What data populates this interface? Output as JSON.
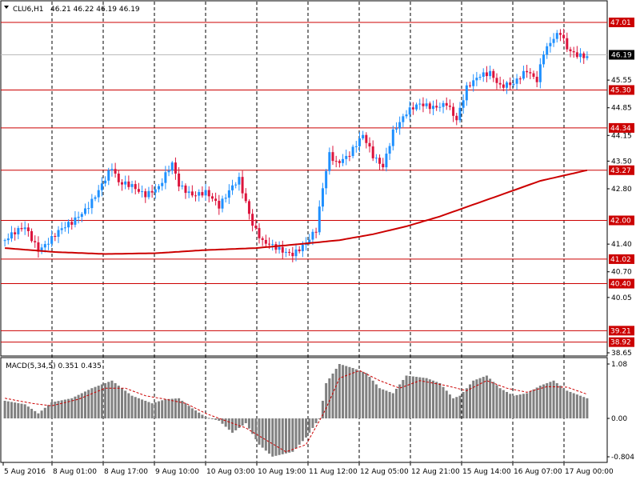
{
  "window": {
    "symbol_label": "CLU6,H1",
    "ohlc_text": "46.21 46.22 46.19 46.19"
  },
  "colors": {
    "background": "#ffffff",
    "grid": "#000000",
    "bull_candle": "#1e90ff",
    "bear_candle": "#dc143c",
    "level_line": "#cc0000",
    "ma_line": "#cc0000",
    "macd_hist": "#808080",
    "macd_signal": "#cc0000",
    "current_price_tag": "#000000"
  },
  "chart_data": [
    {
      "type": "candlestick",
      "title": "CLU6,H1",
      "timeframe": "H1",
      "ylim": [
        38.5,
        47.5
      ],
      "y_ticks": [
        47.01,
        45.55,
        44.85,
        44.15,
        43.5,
        42.8,
        41.4,
        40.7,
        40.05,
        38.65
      ],
      "x_labels": [
        "5 Aug 2016",
        "8 Aug 01:00",
        "8 Aug 17:00",
        "9 Aug 10:00",
        "10 Aug 03:00",
        "10 Aug 19:00",
        "11 Aug 12:00",
        "12 Aug 05:00",
        "12 Aug 21:00",
        "15 Aug 14:00",
        "16 Aug 07:00",
        "17 Aug 00:00"
      ],
      "current_price": 46.19,
      "levels": [
        {
          "value": 47.01,
          "label": "47.01"
        },
        {
          "value": 45.3,
          "label": "45.30"
        },
        {
          "value": 44.34,
          "label": "44.34"
        },
        {
          "value": 43.27,
          "label": "43.27"
        },
        {
          "value": 42.0,
          "label": "42.00"
        },
        {
          "value": 41.02,
          "label": "41.02"
        },
        {
          "value": 40.4,
          "label": "40.40"
        },
        {
          "value": 39.21,
          "label": "39.21"
        },
        {
          "value": 38.92,
          "label": "38.92"
        }
      ],
      "price_path": [
        [
          0,
          41.5
        ],
        [
          6,
          41.8
        ],
        [
          10,
          41.3
        ],
        [
          16,
          41.7
        ],
        [
          20,
          41.9
        ],
        [
          24,
          42.3
        ],
        [
          28,
          42.8
        ],
        [
          32,
          43.3
        ],
        [
          34,
          42.9
        ],
        [
          38,
          42.9
        ],
        [
          42,
          42.7
        ],
        [
          46,
          42.8
        ],
        [
          50,
          43.4
        ],
        [
          52,
          42.9
        ],
        [
          56,
          42.7
        ],
        [
          60,
          42.7
        ],
        [
          64,
          42.3
        ],
        [
          68,
          42.9
        ],
        [
          70,
          43.1
        ],
        [
          72,
          42.5
        ],
        [
          74,
          41.9
        ],
        [
          77,
          41.4
        ],
        [
          81,
          41.3
        ],
        [
          86,
          41.2
        ],
        [
          90,
          41.4
        ],
        [
          93,
          41.7
        ],
        [
          95,
          42.8
        ],
        [
          97,
          43.7
        ],
        [
          99,
          43.5
        ],
        [
          103,
          43.7
        ],
        [
          107,
          44.1
        ],
        [
          110,
          43.6
        ],
        [
          113,
          43.4
        ],
        [
          116,
          44.3
        ],
        [
          120,
          44.7
        ],
        [
          124,
          44.9
        ],
        [
          128,
          44.9
        ],
        [
          132,
          45.0
        ],
        [
          135,
          44.5
        ],
        [
          138,
          45.3
        ],
        [
          142,
          45.7
        ],
        [
          145,
          45.8
        ],
        [
          148,
          45.4
        ],
        [
          152,
          45.4
        ],
        [
          156,
          45.8
        ],
        [
          159,
          45.6
        ],
        [
          161,
          46.3
        ],
        [
          164,
          46.6
        ],
        [
          166,
          46.7
        ],
        [
          168,
          46.3
        ],
        [
          170,
          46.2
        ],
        [
          174,
          46.2
        ]
      ],
      "ma_path": [
        [
          0,
          41.3
        ],
        [
          15,
          41.2
        ],
        [
          30,
          41.15
        ],
        [
          45,
          41.17
        ],
        [
          60,
          41.25
        ],
        [
          75,
          41.3
        ],
        [
          88,
          41.4
        ],
        [
          100,
          41.5
        ],
        [
          110,
          41.65
        ],
        [
          120,
          41.85
        ],
        [
          130,
          42.1
        ],
        [
          140,
          42.4
        ],
        [
          150,
          42.7
        ],
        [
          160,
          43.0
        ],
        [
          174,
          43.27
        ]
      ]
    },
    {
      "type": "bar",
      "title": "MACD(5,34,5) 0.351 0.435",
      "ylim": [
        -0.804,
        1.08
      ],
      "y_ticks": [
        1.08,
        0.0,
        -0.804
      ],
      "hist_path": [
        [
          0,
          0.35
        ],
        [
          6,
          0.28
        ],
        [
          10,
          0.1
        ],
        [
          14,
          0.32
        ],
        [
          20,
          0.4
        ],
        [
          26,
          0.6
        ],
        [
          32,
          0.75
        ],
        [
          38,
          0.45
        ],
        [
          44,
          0.3
        ],
        [
          48,
          0.38
        ],
        [
          52,
          0.4
        ],
        [
          56,
          0.2
        ],
        [
          60,
          0.03
        ],
        [
          64,
          -0.05
        ],
        [
          68,
          -0.3
        ],
        [
          72,
          -0.1
        ],
        [
          76,
          -0.55
        ],
        [
          80,
          -0.8
        ],
        [
          86,
          -0.7
        ],
        [
          90,
          -0.4
        ],
        [
          94,
          0.0
        ],
        [
          96,
          0.7
        ],
        [
          100,
          1.08
        ],
        [
          104,
          1.0
        ],
        [
          108,
          0.9
        ],
        [
          112,
          0.6
        ],
        [
          116,
          0.5
        ],
        [
          120,
          0.85
        ],
        [
          126,
          0.8
        ],
        [
          130,
          0.7
        ],
        [
          134,
          0.4
        ],
        [
          136,
          0.45
        ],
        [
          140,
          0.75
        ],
        [
          144,
          0.85
        ],
        [
          148,
          0.6
        ],
        [
          152,
          0.45
        ],
        [
          156,
          0.5
        ],
        [
          160,
          0.65
        ],
        [
          164,
          0.75
        ],
        [
          168,
          0.55
        ],
        [
          174,
          0.4
        ]
      ],
      "signal_path": [
        [
          0,
          0.4
        ],
        [
          8,
          0.3
        ],
        [
          14,
          0.25
        ],
        [
          22,
          0.38
        ],
        [
          30,
          0.6
        ],
        [
          36,
          0.6
        ],
        [
          42,
          0.45
        ],
        [
          48,
          0.38
        ],
        [
          54,
          0.3
        ],
        [
          60,
          0.1
        ],
        [
          66,
          -0.05
        ],
        [
          72,
          -0.2
        ],
        [
          78,
          -0.45
        ],
        [
          84,
          -0.7
        ],
        [
          90,
          -0.55
        ],
        [
          96,
          0.2
        ],
        [
          100,
          0.8
        ],
        [
          106,
          0.95
        ],
        [
          112,
          0.75
        ],
        [
          118,
          0.6
        ],
        [
          124,
          0.75
        ],
        [
          132,
          0.65
        ],
        [
          138,
          0.55
        ],
        [
          144,
          0.75
        ],
        [
          150,
          0.6
        ],
        [
          156,
          0.52
        ],
        [
          162,
          0.63
        ],
        [
          168,
          0.62
        ],
        [
          174,
          0.48
        ]
      ]
    }
  ]
}
